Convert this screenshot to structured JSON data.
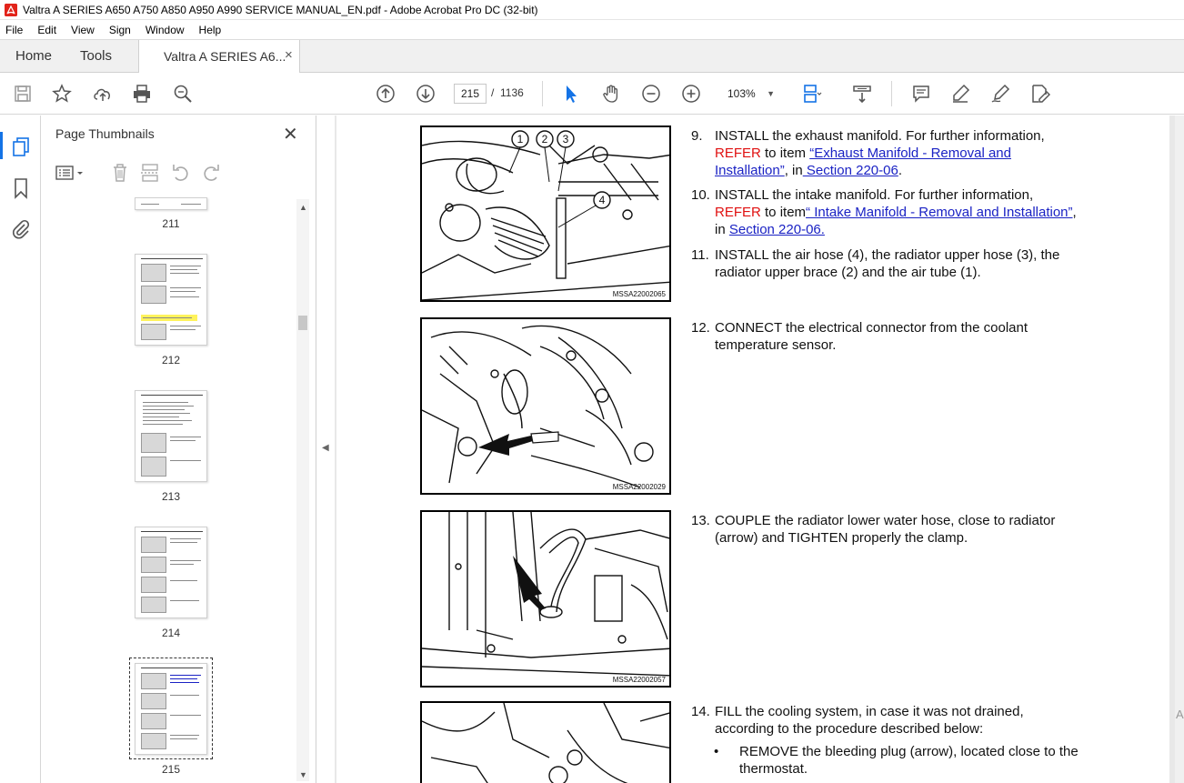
{
  "window": {
    "title": "Valtra A SERIES A650 A750 A850 A950 A990 SERVICE MANUAL_EN.pdf - Adobe Acrobat Pro DC (32-bit)"
  },
  "menu": [
    "File",
    "Edit",
    "View",
    "Sign",
    "Window",
    "Help"
  ],
  "tabs": {
    "home": "Home",
    "tools": "Tools",
    "doc": "Valtra A SERIES A6...",
    "close": "×"
  },
  "toolbar": {
    "page_current": "215",
    "page_sep": "/",
    "page_total": "1136",
    "zoom": "103%",
    "zoom_caret": "▼"
  },
  "panel": {
    "title": "Page Thumbnails",
    "close": "✕",
    "thumbs": [
      {
        "num": "211"
      },
      {
        "num": "212"
      },
      {
        "num": "213"
      },
      {
        "num": "214"
      },
      {
        "num": "215"
      }
    ],
    "scroll_up": "▲",
    "scroll_down": "▼"
  },
  "splitter_arrow": "◀",
  "doc": {
    "fig_captions": [
      "MSSA22002065",
      "MSSA22002029",
      "MSSA22002057"
    ],
    "callouts": [
      "1",
      "2",
      "3",
      "4"
    ],
    "steps": {
      "s9": {
        "num": "9.",
        "a": "INSTALL the exhaust manifold. For further information,",
        "refer": "REFER",
        "b": " to item ",
        "link1": "“Exhaust Manifold - Removal and Installation”",
        "c": ", in",
        "link2": " Section 220-06",
        "d": "."
      },
      "s10": {
        "num": "10.",
        "a": "INSTALL the intake manifold. For further information,",
        "refer": "REFER",
        "b": " to item",
        "link1": "“ Intake Manifold - Removal and Installation”",
        "c": ", in ",
        "link2": "Section 220-06."
      },
      "s11": {
        "num": "11.",
        "text": "INSTALL the air hose (4), the radiator upper hose (3), the radiator upper brace (2) and the air tube (1)."
      },
      "s12": {
        "num": "12.",
        "text": "CONNECT the electrical connector from the coolant temperature sensor."
      },
      "s13": {
        "num": "13.",
        "text": "COUPLE the radiator lower water hose, close to radiator (arrow) and TIGHTEN properly the clamp."
      },
      "s14": {
        "num": "14.",
        "text": "FILL the cooling system, in case it was not drained, according to the procedure described below:"
      },
      "b1": {
        "dot": "•",
        "text": "REMOVE the bleeding plug (arrow), located close to the thermostat."
      }
    },
    "edge_char": "A"
  },
  "colors": {
    "accent": "#1473e6",
    "refer": "#e01010",
    "link": "#1a22c4",
    "highlight": "#fff35c"
  }
}
